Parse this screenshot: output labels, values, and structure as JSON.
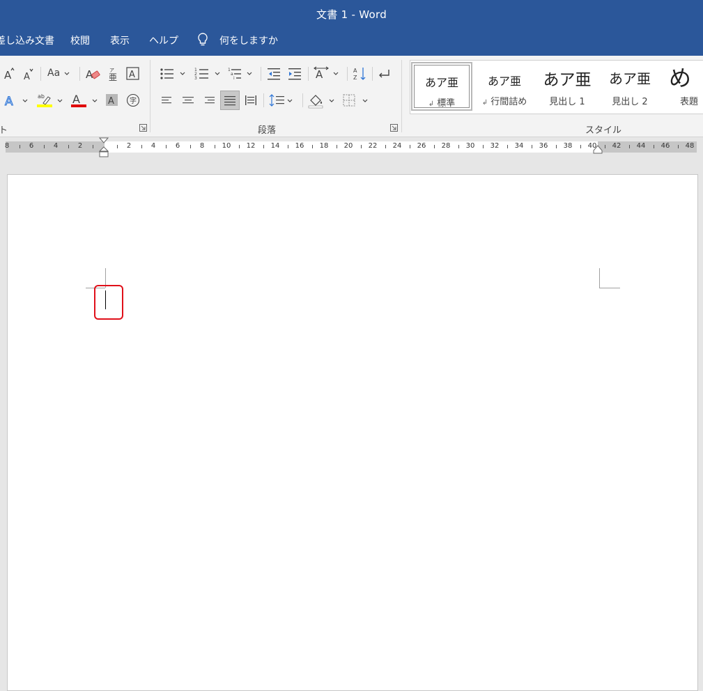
{
  "titlebar": {
    "title": "文書 1  -  Word"
  },
  "menu": {
    "tabs": [
      "差し込み文書",
      "校閲",
      "表示",
      "ヘルプ"
    ],
    "tell_me": "何をしますか"
  },
  "ribbon": {
    "groups": {
      "font": "ト",
      "paragraph": "段落",
      "styles": "スタイル"
    },
    "font_buttons": {
      "case": "Aa"
    },
    "styles_gallery": [
      {
        "preview": "あア亜",
        "name": "標準",
        "mark": "↲"
      },
      {
        "preview": "あア亜",
        "name": "行間詰め",
        "mark": "↲"
      },
      {
        "preview": "あア亜",
        "name": "見出し 1",
        "mark": ""
      },
      {
        "preview": "あア亜",
        "name": "見出し 2",
        "mark": ""
      },
      {
        "preview": "め",
        "name": "表題",
        "mark": ""
      }
    ],
    "colors": {
      "highlight": "#ffff00",
      "font_color": "#e00000",
      "accent": "#2b579a"
    }
  },
  "ruler": {
    "left_labels": [
      "8",
      "6",
      "4",
      "2"
    ],
    "right_labels": [
      "2",
      "4",
      "6",
      "8",
      "10",
      "12",
      "14",
      "16",
      "18",
      "20",
      "22",
      "24",
      "26",
      "28",
      "30",
      "32",
      "34",
      "36",
      "38",
      "40",
      "42",
      "44",
      "46",
      "48"
    ]
  },
  "document": {
    "highlight_color": "#e0101a"
  }
}
